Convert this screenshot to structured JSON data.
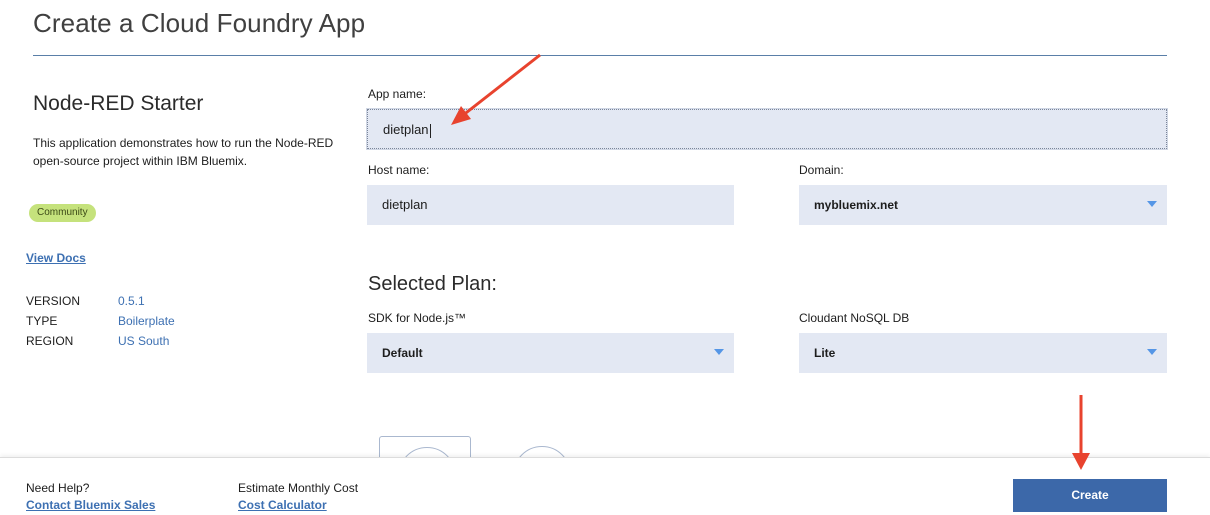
{
  "page": {
    "title": "Create a Cloud Foundry App"
  },
  "starter": {
    "title": "Node-RED Starter",
    "description": "This application demonstrates how to run the Node-RED open-source project within IBM Bluemix.",
    "badge": "Community",
    "view_docs": "View Docs",
    "meta": [
      {
        "key": "VERSION",
        "value": "0.5.1"
      },
      {
        "key": "TYPE",
        "value": "Boilerplate"
      },
      {
        "key": "REGION",
        "value": "US South"
      }
    ]
  },
  "form": {
    "app_name_label": "App name:",
    "app_name_value": "dietplan",
    "host_name_label": "Host name:",
    "host_name_value": "dietplan",
    "domain_label": "Domain:",
    "domain_value": "mybluemix.net"
  },
  "plan": {
    "heading": "Selected Plan:",
    "sdk_label": "SDK for Node.js™",
    "sdk_value": "Default",
    "db_label": "Cloudant NoSQL DB",
    "db_value": "Lite"
  },
  "footer": {
    "help_label": "Need Help?",
    "help_link": "Contact Bluemix Sales",
    "cost_label": "Estimate Monthly Cost",
    "cost_link": "Cost Calculator",
    "create_button": "Create"
  },
  "colors": {
    "accent": "#3d70b2",
    "button": "#3c68a9",
    "field_bg": "#e3e8f3",
    "badge_bg": "#c5e27c",
    "annotation_arrow": "#e8432e"
  }
}
